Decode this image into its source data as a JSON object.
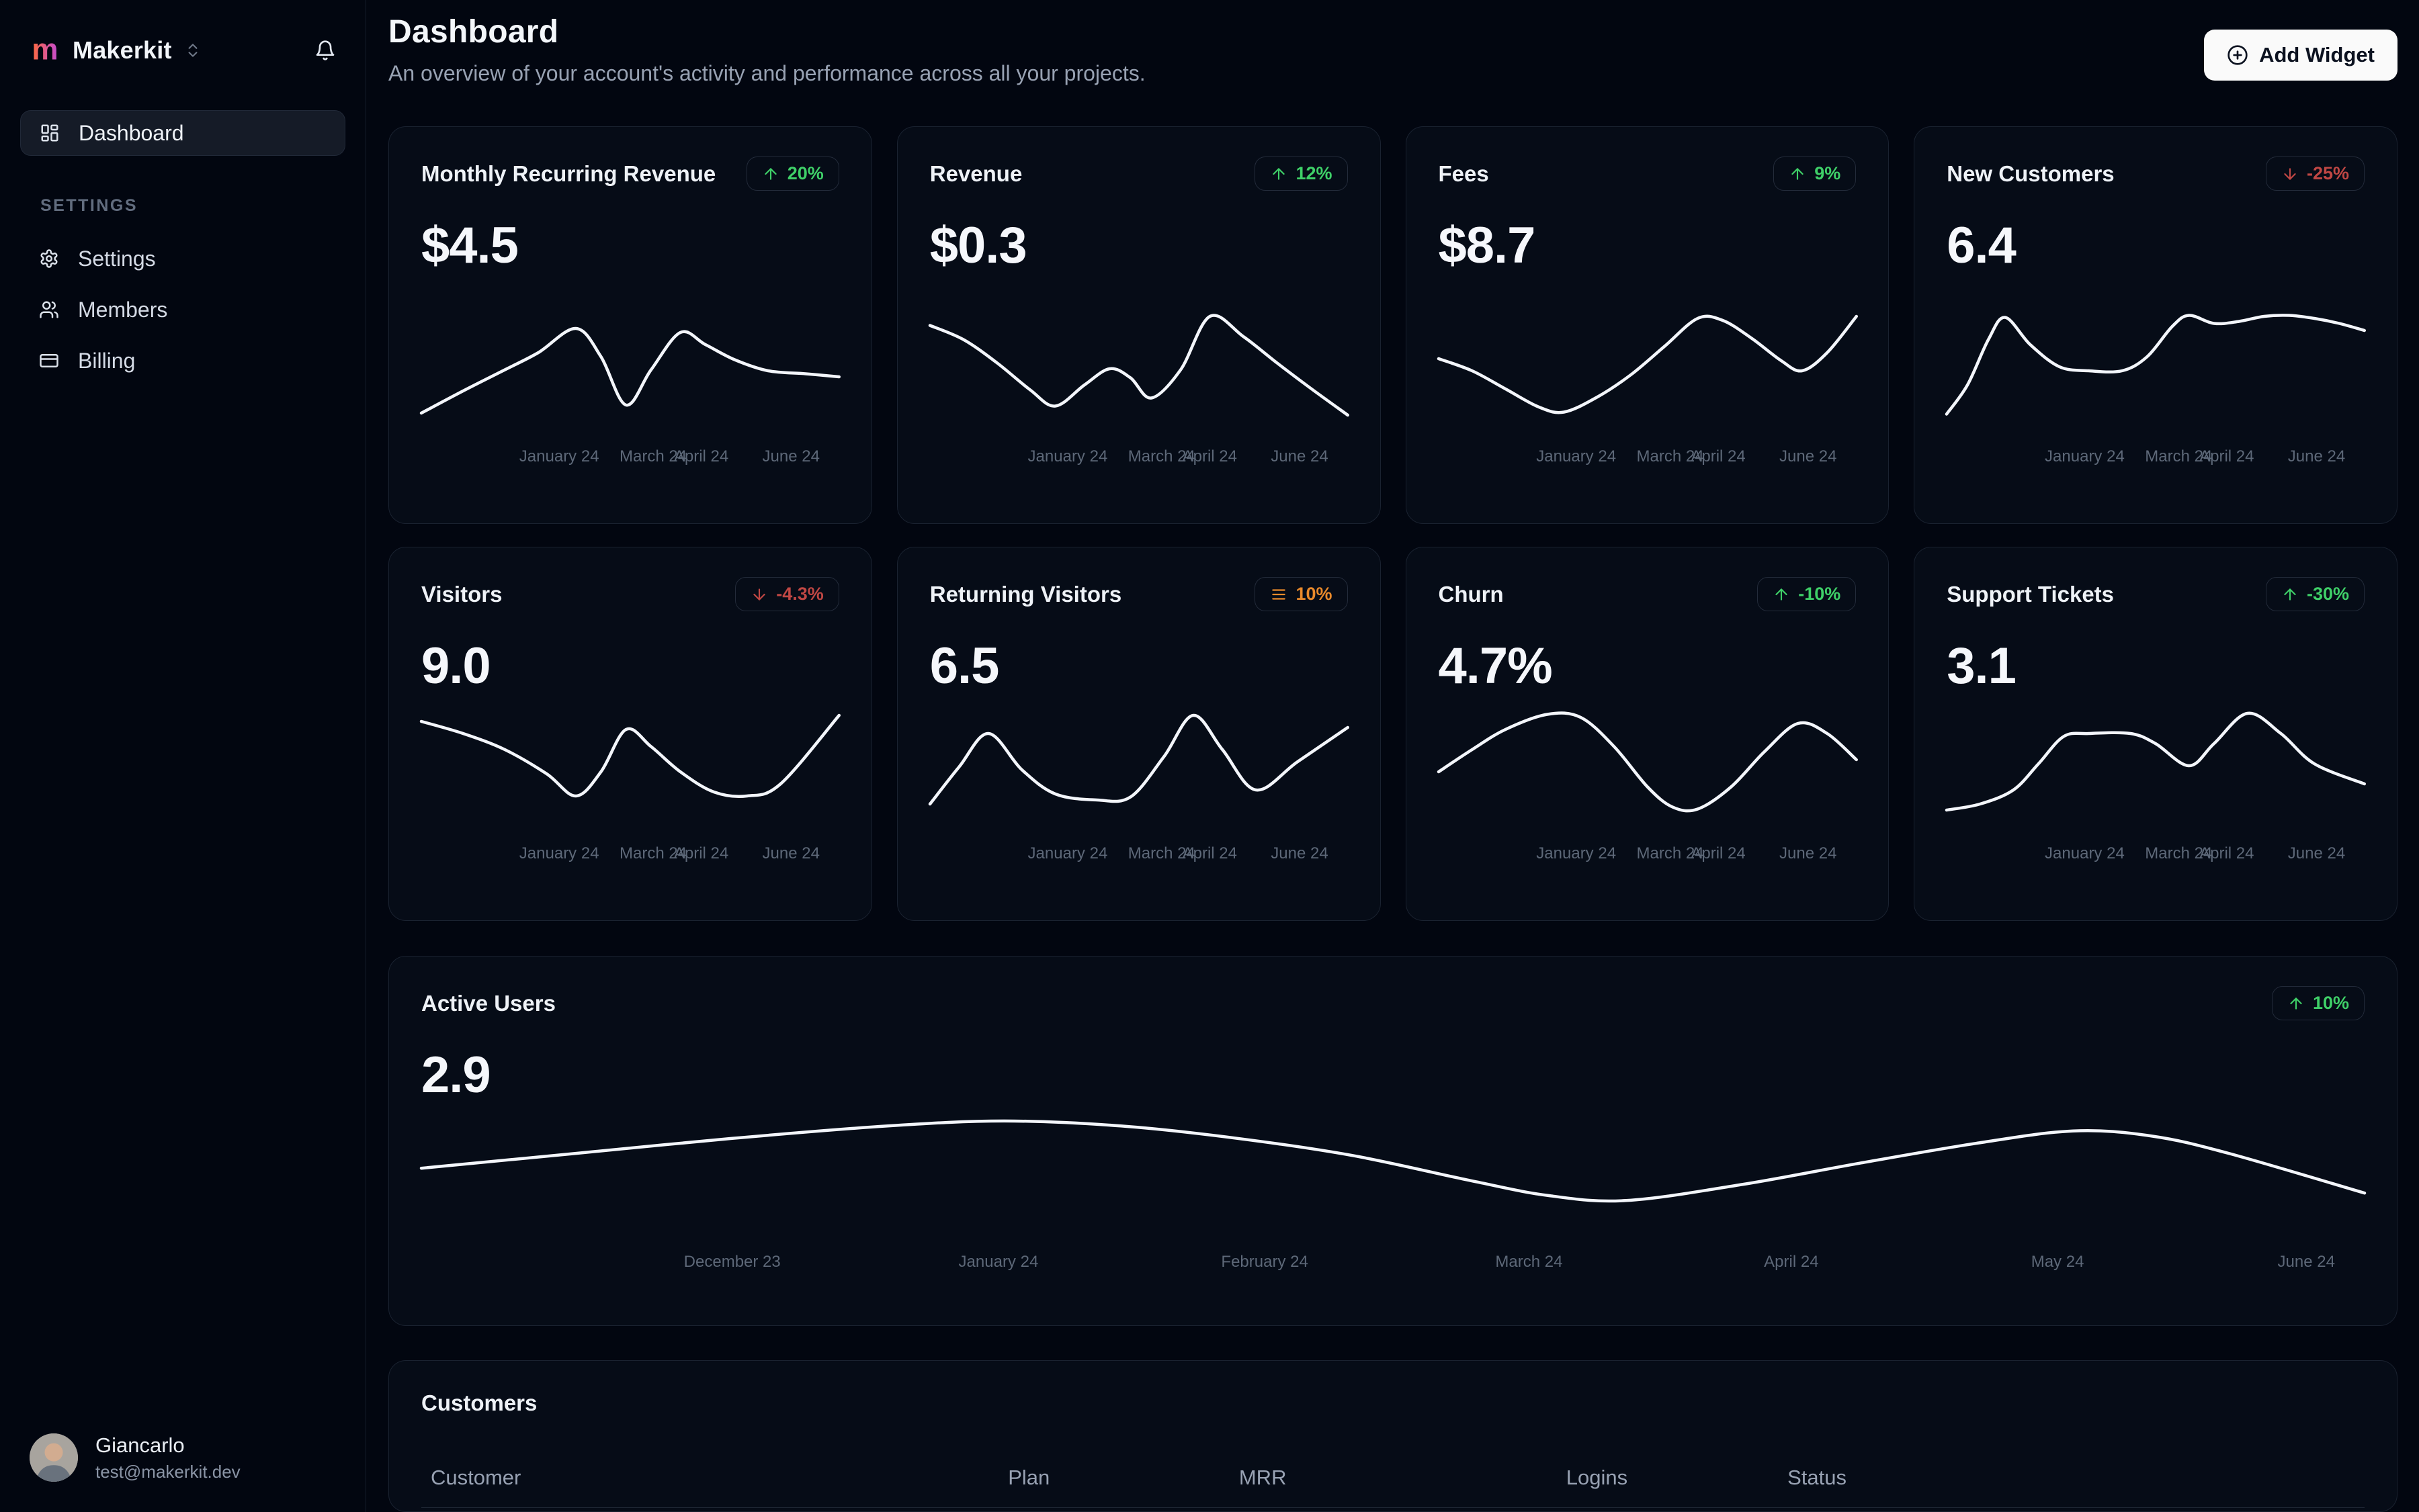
{
  "colors": {
    "green": "#3fd068",
    "red": "#c04744",
    "orange": "#e98a2b",
    "line": "#f3f6fb",
    "accent_button_bg": "#fafafa"
  },
  "brand": {
    "name": "Makerkit"
  },
  "sidebar": {
    "nav": [
      {
        "label": "Dashboard"
      }
    ],
    "section_label": "SETTINGS",
    "settings_nav": [
      {
        "label": "Settings"
      },
      {
        "label": "Members"
      },
      {
        "label": "Billing"
      }
    ],
    "user": {
      "name": "Giancarlo",
      "email": "test@makerkit.dev"
    }
  },
  "header": {
    "title": "Dashboard",
    "subtitle": "An overview of your account's activity and performance across all your projects.",
    "add_widget_label": "Add Widget"
  },
  "months_short": [
    "January 24",
    "March 24",
    "April 24",
    "June 24"
  ],
  "cards": [
    {
      "title": "Monthly Recurring Revenue",
      "value": "$4.5",
      "badge": {
        "value": "20%",
        "trend": "up",
        "tone": "green"
      },
      "spark": [
        [
          0,
          98
        ],
        [
          10,
          76
        ],
        [
          20,
          55
        ],
        [
          28,
          38
        ],
        [
          37,
          14
        ],
        [
          43,
          42
        ],
        [
          49,
          90
        ],
        [
          55,
          55
        ],
        [
          62,
          18
        ],
        [
          68,
          30
        ],
        [
          75,
          45
        ],
        [
          83,
          56
        ],
        [
          92,
          59
        ],
        [
          100,
          62
        ]
      ]
    },
    {
      "title": "Revenue",
      "value": "$0.3",
      "badge": {
        "value": "12%",
        "trend": "up",
        "tone": "green"
      },
      "spark": [
        [
          0,
          11
        ],
        [
          8,
          25
        ],
        [
          16,
          48
        ],
        [
          24,
          75
        ],
        [
          30,
          91
        ],
        [
          37,
          70
        ],
        [
          43,
          54
        ],
        [
          48,
          63
        ],
        [
          53,
          83
        ],
        [
          60,
          55
        ],
        [
          67,
          2
        ],
        [
          75,
          22
        ],
        [
          83,
          48
        ],
        [
          91,
          73
        ],
        [
          100,
          100
        ]
      ]
    },
    {
      "title": "Fees",
      "value": "$8.7",
      "badge": {
        "value": "9%",
        "trend": "up",
        "tone": "green"
      },
      "spark": [
        [
          0,
          44
        ],
        [
          8,
          56
        ],
        [
          16,
          74
        ],
        [
          24,
          92
        ],
        [
          30,
          97
        ],
        [
          38,
          82
        ],
        [
          46,
          60
        ],
        [
          54,
          32
        ],
        [
          62,
          4
        ],
        [
          68,
          6
        ],
        [
          75,
          24
        ],
        [
          82,
          46
        ],
        [
          87,
          56
        ],
        [
          93,
          38
        ],
        [
          100,
          2
        ]
      ]
    },
    {
      "title": "New Customers",
      "value": "6.4",
      "badge": {
        "value": "-25%",
        "trend": "down",
        "tone": "red"
      },
      "spark": [
        [
          0,
          99
        ],
        [
          5,
          70
        ],
        [
          10,
          25
        ],
        [
          14,
          3
        ],
        [
          20,
          30
        ],
        [
          27,
          52
        ],
        [
          34,
          56
        ],
        [
          42,
          56
        ],
        [
          48,
          42
        ],
        [
          54,
          12
        ],
        [
          58,
          1
        ],
        [
          64,
          9
        ],
        [
          70,
          7
        ],
        [
          76,
          2
        ],
        [
          82,
          1
        ],
        [
          88,
          4
        ],
        [
          94,
          9
        ],
        [
          100,
          16
        ]
      ]
    },
    {
      "title": "Visitors",
      "value": "9.0",
      "badge": {
        "value": "-4.3%",
        "trend": "down",
        "tone": "red"
      },
      "spark": [
        [
          0,
          10
        ],
        [
          10,
          22
        ],
        [
          20,
          38
        ],
        [
          30,
          62
        ],
        [
          37,
          84
        ],
        [
          43,
          60
        ],
        [
          49,
          18
        ],
        [
          55,
          35
        ],
        [
          62,
          60
        ],
        [
          70,
          80
        ],
        [
          78,
          84
        ],
        [
          86,
          72
        ],
        [
          100,
          4
        ]
      ]
    },
    {
      "title": "Returning Visitors",
      "value": "6.5",
      "badge": {
        "value": "10%",
        "trend": "flat",
        "tone": "orange"
      },
      "spark": [
        [
          0,
          92
        ],
        [
          7,
          55
        ],
        [
          14,
          22
        ],
        [
          22,
          58
        ],
        [
          30,
          82
        ],
        [
          40,
          88
        ],
        [
          48,
          85
        ],
        [
          56,
          45
        ],
        [
          63,
          4
        ],
        [
          70,
          38
        ],
        [
          78,
          78
        ],
        [
          88,
          50
        ],
        [
          100,
          16
        ]
      ]
    },
    {
      "title": "Churn",
      "value": "4.7%",
      "badge": {
        "value": "-10%",
        "trend": "up",
        "tone": "green"
      },
      "spark": [
        [
          0,
          60
        ],
        [
          8,
          38
        ],
        [
          16,
          18
        ],
        [
          26,
          3
        ],
        [
          34,
          6
        ],
        [
          42,
          35
        ],
        [
          50,
          75
        ],
        [
          56,
          95
        ],
        [
          62,
          97
        ],
        [
          70,
          75
        ],
        [
          78,
          40
        ],
        [
          86,
          12
        ],
        [
          93,
          22
        ],
        [
          100,
          48
        ]
      ]
    },
    {
      "title": "Support Tickets",
      "value": "3.1",
      "badge": {
        "value": "-30%",
        "trend": "up",
        "tone": "green"
      },
      "spark": [
        [
          0,
          98
        ],
        [
          8,
          92
        ],
        [
          16,
          78
        ],
        [
          22,
          52
        ],
        [
          28,
          25
        ],
        [
          34,
          22
        ],
        [
          44,
          22
        ],
        [
          50,
          32
        ],
        [
          58,
          54
        ],
        [
          64,
          32
        ],
        [
          72,
          2
        ],
        [
          80,
          22
        ],
        [
          88,
          52
        ],
        [
          100,
          72
        ]
      ]
    }
  ],
  "active_users": {
    "title": "Active Users",
    "value": "2.9",
    "badge": {
      "value": "10%",
      "trend": "up",
      "tone": "green"
    },
    "months": [
      "December 23",
      "January 24",
      "February 24",
      "March 24",
      "April 24",
      "May 24",
      "June 24"
    ],
    "spark": [
      [
        0,
        52
      ],
      [
        8,
        40
      ],
      [
        16,
        28
      ],
      [
        24,
        18
      ],
      [
        30,
        14
      ],
      [
        36,
        18
      ],
      [
        42,
        28
      ],
      [
        48,
        42
      ],
      [
        54,
        62
      ],
      [
        58,
        74
      ],
      [
        62,
        78
      ],
      [
        68,
        65
      ],
      [
        74,
        48
      ],
      [
        80,
        32
      ],
      [
        85,
        22
      ],
      [
        89,
        26
      ],
      [
        93,
        40
      ],
      [
        100,
        72
      ]
    ]
  },
  "customers": {
    "title": "Customers",
    "columns": [
      "Customer",
      "Plan",
      "MRR",
      "Logins",
      "Status"
    ]
  },
  "chart_data": {
    "type": "line",
    "title": "Active Users",
    "x": [
      "December 23",
      "January 24",
      "February 24",
      "March 24",
      "April 24",
      "May 24",
      "June 24"
    ],
    "series": [
      {
        "name": "Active Users",
        "values": [
          2.4,
          2.9,
          3.1,
          2.2,
          2.6,
          3.0,
          2.3
        ]
      }
    ],
    "legend_position": "none",
    "grid": false
  }
}
